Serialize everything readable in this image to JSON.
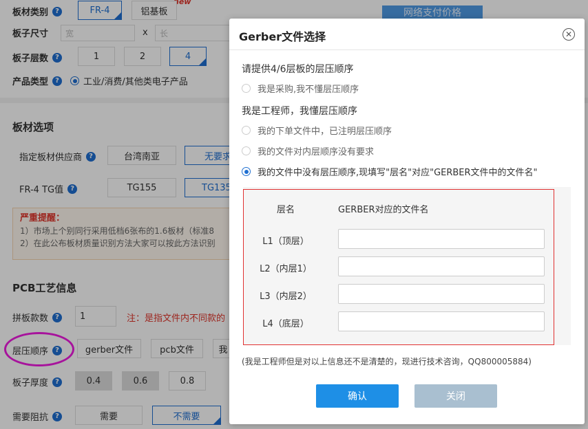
{
  "page": {
    "net_pay_label": "网络支付价格",
    "new_tag": "new",
    "rows": {
      "material": {
        "label": "板材类别",
        "options": [
          "FR-4",
          "铝基板"
        ]
      },
      "size": {
        "label": "板子尺寸",
        "width_placeholder": "宽",
        "times": "x",
        "length_placeholder": "长"
      },
      "layers": {
        "label": "板子层数",
        "options": [
          "1",
          "2",
          "4"
        ]
      },
      "product": {
        "label": "产品类型",
        "option": "工业/消费/其他类电子产品"
      }
    },
    "board_section": {
      "title": "板材选项",
      "supplier": {
        "label": "指定板材供应商",
        "options": [
          "台湾南亚",
          "无要求"
        ]
      },
      "tg": {
        "label": "FR-4 TG值",
        "options": [
          "TG155",
          "TG135"
        ]
      }
    },
    "warning": {
      "title": "严重提醒：",
      "line1": "1）市场上个别同行采用低档6张布的1.6板材（标准8",
      "line2": "2）在此公布板材质量识别方法大家可以按此方法识别"
    },
    "pcb_section": {
      "title": "PCB工艺信息",
      "panel": {
        "label": "拼板款数",
        "value": "1",
        "note": "注：是指文件内不同款的"
      },
      "stackup": {
        "label": "层压顺序",
        "options": [
          "gerber文件",
          "pcb文件",
          "我"
        ]
      },
      "thickness": {
        "label": "板子厚度",
        "options": [
          "0.4",
          "0.6",
          "0.8"
        ]
      },
      "impedance": {
        "label": "需要阻抗",
        "options": [
          "需要",
          "不需要"
        ]
      }
    }
  },
  "modal": {
    "title": "Gerber文件选择",
    "close_icon": "close-icon",
    "prompt": "请提供4/6层板的层压顺序",
    "buyer_option": "我是采购,我不懂层压顺序",
    "engineer_heading": "我是工程师，我懂层压顺序",
    "engineer_options": [
      {
        "label": "我的下单文件中，已注明层压顺序",
        "selected": false
      },
      {
        "label": "我的文件对内层顺序没有要求",
        "selected": false
      },
      {
        "label": "我的文件中没有层压顺序,现填写\"层名\"对应\"GERBER文件中的文件名\"",
        "selected": true
      }
    ],
    "table": {
      "header_layer": "层名",
      "header_file": "GERBER对应的文件名",
      "rows": [
        {
          "layer": "L1（顶层）",
          "value": ""
        },
        {
          "layer": "L2（内层1）",
          "value": ""
        },
        {
          "layer": "L3（内层2）",
          "value": ""
        },
        {
          "layer": "L4（底层）",
          "value": ""
        }
      ]
    },
    "consult_note": "(我是工程师但是对以上信息还不是清楚的，现进行技术咨询，QQ800005884)",
    "confirm_label": "确认",
    "close_label": "关闭"
  }
}
